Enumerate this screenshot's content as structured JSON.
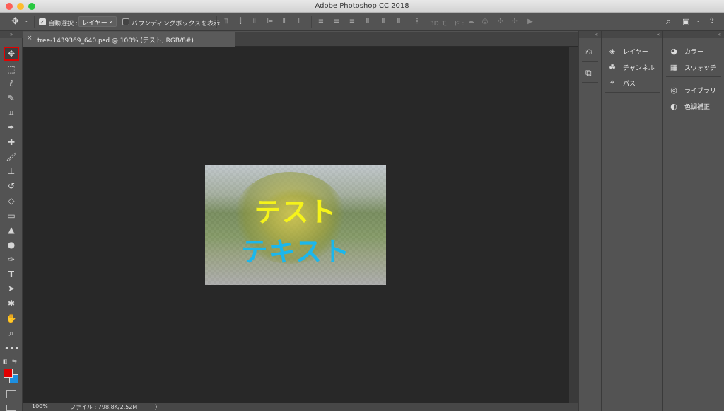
{
  "window": {
    "title": "Adobe Photoshop CC 2018"
  },
  "traffic_lights": {
    "close": "#fd5f57",
    "minimize": "#febc2e",
    "zoom": "#28c840"
  },
  "options": {
    "auto_select_label": "自動選択 :",
    "auto_select_value": "レイヤー",
    "show_bbox_label": "バウンディングボックスを表示",
    "mode_3d_label": "3D モード :"
  },
  "document": {
    "tab_title": "tree-1439369_640.psd @ 100% (テスト, RGB/8#)",
    "close_glyph": "×",
    "text_layer_1": "テスト",
    "text_layer_2": "テキスト",
    "text_color_1": "#f5f31a",
    "text_color_2": "#1bb7ec"
  },
  "status": {
    "zoom": "100%",
    "file_info": "ファイル : 798.8K/2.52M",
    "arrow": "〉"
  },
  "colors": {
    "foreground": "#e30000",
    "background": "#1d8fe0",
    "highlight": "#e30000"
  },
  "panels": {
    "col1": [
      {
        "icon": "history-icon",
        "label": ""
      },
      {
        "icon": "properties-icon",
        "label": ""
      }
    ],
    "col2": [
      {
        "icon": "layers-icon",
        "label": "レイヤー"
      },
      {
        "icon": "channels-icon",
        "label": "チャンネル"
      },
      {
        "icon": "paths-icon",
        "label": "パス"
      }
    ],
    "col3": [
      {
        "icon": "color-icon",
        "label": "カラー"
      },
      {
        "icon": "swatches-icon",
        "label": "スウォッチ"
      },
      {
        "icon": "libraries-icon",
        "label": "ライブラリ"
      },
      {
        "icon": "adjustments-icon",
        "label": "色調補正"
      }
    ]
  },
  "tools": [
    "move-tool-icon",
    "marquee-tool-icon",
    "lasso-tool-icon",
    "quick-select-tool-icon",
    "crop-tool-icon",
    "eyedropper-tool-icon",
    "healing-brush-tool-icon",
    "brush-tool-icon",
    "stamp-tool-icon",
    "history-brush-tool-icon",
    "eraser-tool-icon",
    "gradient-tool-icon",
    "blur-tool-icon",
    "dodge-tool-icon",
    "pen-tool-icon",
    "type-tool-icon",
    "path-select-tool-icon",
    "shape-tool-icon",
    "hand-tool-icon",
    "zoom-tool-icon",
    "more-tools-icon"
  ]
}
